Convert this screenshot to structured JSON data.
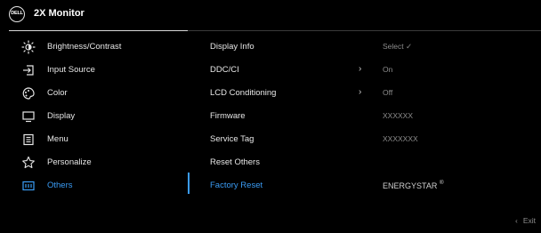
{
  "header": {
    "logo_text": "DELL",
    "title": "2X Monitor"
  },
  "menu": [
    {
      "label": "Brightness/Contrast",
      "icon": "brightness-icon"
    },
    {
      "label": "Input Source",
      "icon": "input-source-icon"
    },
    {
      "label": "Color",
      "icon": "color-palette-icon"
    },
    {
      "label": "Display",
      "icon": "display-icon"
    },
    {
      "label": "Menu",
      "icon": "menu-icon"
    },
    {
      "label": "Personalize",
      "icon": "star-icon"
    },
    {
      "label": "Others",
      "icon": "others-icon",
      "active": true
    }
  ],
  "others": {
    "items": [
      {
        "label": "Display Info",
        "value": "Select ✓"
      },
      {
        "label": "DDC/CI",
        "chevron": "›",
        "value": "On"
      },
      {
        "label": "LCD Conditioning",
        "chevron": "›",
        "value": "Off"
      },
      {
        "label": "Firmware",
        "value": "XXXXXX"
      },
      {
        "label": "Service Tag",
        "value": "XXXXXXX"
      },
      {
        "label": "Reset Others",
        "value": ""
      },
      {
        "label": "Factory Reset",
        "value": "ENERGYSTAR",
        "value_sup": "®",
        "active": true
      }
    ]
  },
  "footer": {
    "chevron": "‹",
    "exit_label": "Exit"
  },
  "colors": {
    "accent": "#3a9cf5",
    "background": "#000000",
    "text": "#e6e6e6",
    "muted": "#8c8c8c"
  }
}
